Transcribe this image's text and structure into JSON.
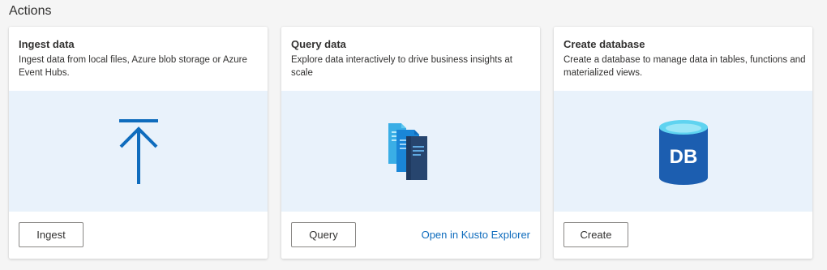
{
  "section": {
    "title": "Actions"
  },
  "cards": [
    {
      "title": "Ingest data",
      "description": "Ingest data from local files, Azure blob storage or Azure Event Hubs.",
      "icon": "upload-arrow-icon",
      "button": "Ingest"
    },
    {
      "title": "Query data",
      "description": "Explore data interactively to drive business insights at scale",
      "icon": "stacked-documents-icon",
      "button": "Query",
      "link": "Open in Kusto Explorer"
    },
    {
      "title": "Create database",
      "description": "Create a database to manage data in tables, functions and materialized views.",
      "icon": "database-icon",
      "icon_text": "DB",
      "button": "Create"
    }
  ],
  "colors": {
    "accent": "#0f6cbd",
    "illustration_bg": "#e9f2fb",
    "db_blue": "#1c5eb0",
    "db_top": "#5fd3f0"
  }
}
